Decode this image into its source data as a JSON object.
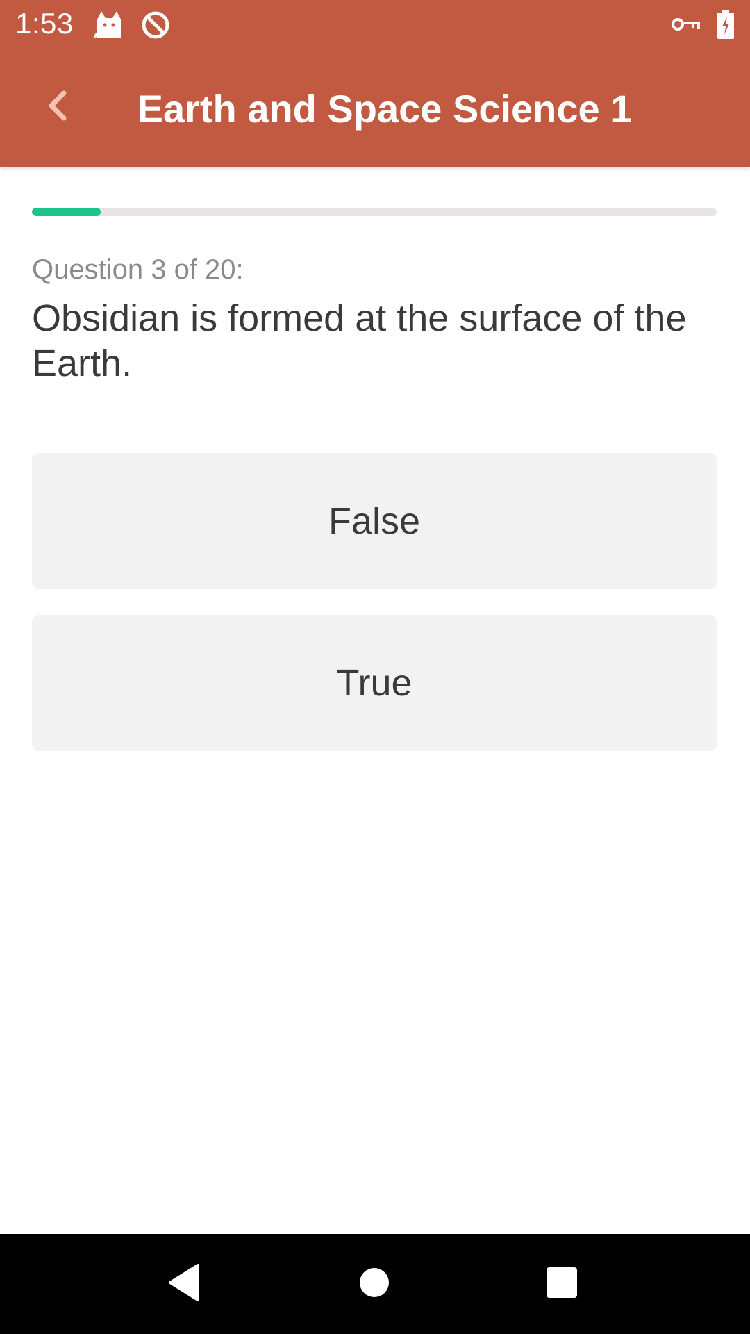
{
  "status_bar": {
    "time": "1:53",
    "icons": [
      "cat-notification-icon",
      "data-saver-icon",
      "vpn-key-icon",
      "battery-charging-icon"
    ]
  },
  "app_bar": {
    "back_icon": "chevron-left-icon",
    "title": "Earth and Space Science 1"
  },
  "progress": {
    "current": 3,
    "total": 20,
    "fraction_shown": 0.1
  },
  "question": {
    "counter_label": "Question 3 of 20:",
    "text": "Obsidian is formed at the surface of the Earth."
  },
  "answers": [
    {
      "label": "False"
    },
    {
      "label": "True"
    }
  ],
  "nav_bar": {
    "icons": [
      "back-triangle-icon",
      "home-circle-icon",
      "recents-square-icon"
    ]
  },
  "colors": {
    "accent": "#c25a42",
    "progress": "#1fc48a",
    "track": "#e8e4e4",
    "answer_bg": "#f2f2f2",
    "text": "#3a3a3a",
    "muted": "#8a8a8a"
  }
}
